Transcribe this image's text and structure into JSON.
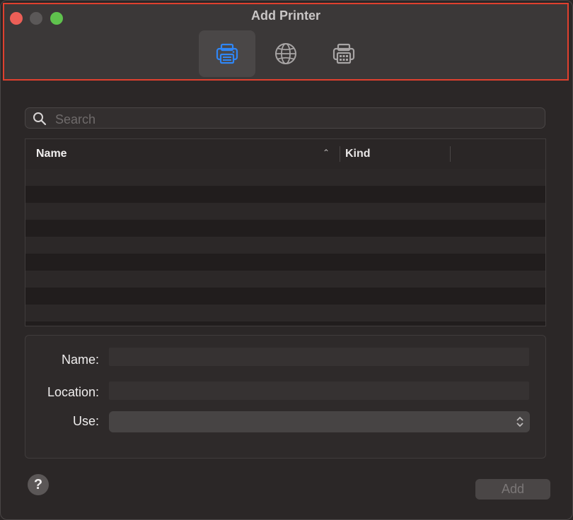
{
  "window": {
    "title": "Add Printer"
  },
  "toolbar": {
    "items": [
      {
        "name": "local-printer-tab",
        "icon": "printer-icon",
        "selected": true
      },
      {
        "name": "ip-printer-tab",
        "icon": "globe-icon",
        "selected": false
      },
      {
        "name": "windows-printer-tab",
        "icon": "printer-grid-icon",
        "selected": false
      }
    ]
  },
  "search": {
    "placeholder": "Search",
    "value": ""
  },
  "table": {
    "columns": [
      {
        "label": "Name",
        "sort": "ascending"
      },
      {
        "label": "Kind"
      }
    ],
    "rows": []
  },
  "form": {
    "name_label": "Name:",
    "name_value": "",
    "location_label": "Location:",
    "location_value": "",
    "use_label": "Use:",
    "use_value": ""
  },
  "footer": {
    "help_label": "?",
    "add_label": "Add"
  },
  "colors": {
    "accent": "#2f86f6",
    "close": "#ec5f57",
    "maximize": "#5fc24d",
    "highlight_border": "#e0402e"
  }
}
